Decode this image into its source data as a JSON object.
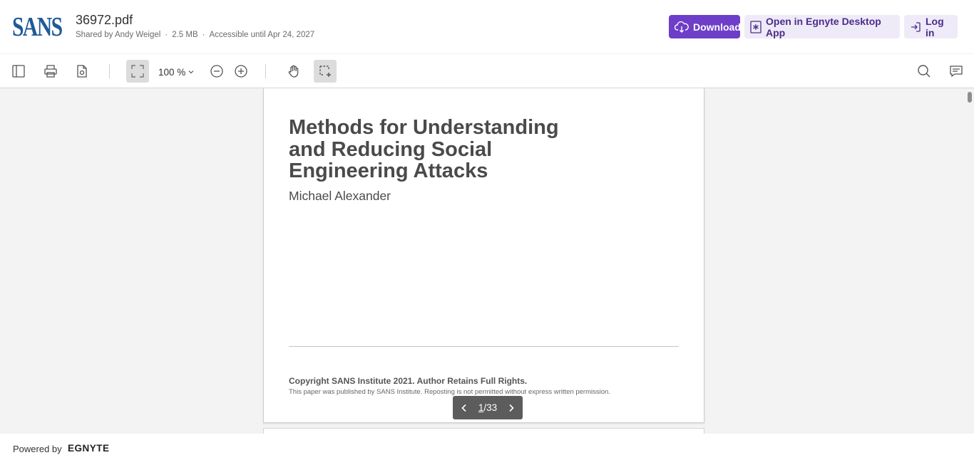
{
  "header": {
    "logo_text": "SANS",
    "file_name": "36972.pdf",
    "shared_by": "Shared by Andy Weigel",
    "file_size": "2.5 MB",
    "access_until": "Accessible until Apr 24, 2027",
    "separator": "·",
    "download_label": "Download",
    "open_desktop_label": "Open in Egnyte Desktop App",
    "login_label": "Log in",
    "accent_color": "#6e3ec9"
  },
  "toolbar": {
    "zoom_value": "100 %",
    "icons": [
      "sidebar-toggle-icon",
      "print-icon",
      "document-settings-icon",
      "fit-page-icon",
      "zoom-out-icon",
      "zoom-in-icon",
      "pan-hand-icon",
      "area-select-icon",
      "search-icon",
      "comments-icon"
    ]
  },
  "document": {
    "title": "Methods for Understanding\nand Reducing Social\nEngineering Attacks",
    "author": "Michael Alexander",
    "copyright": "Copyright SANS Institute 2021. Author Retains Full Rights.",
    "notice": "This paper was published by SANS Institute. Reposting is not permitted without express written permission."
  },
  "pager": {
    "current_page": "1",
    "separator": "/",
    "total_pages": "33"
  },
  "footer": {
    "powered_by": "Powered by",
    "brand": "EGNYTE"
  }
}
